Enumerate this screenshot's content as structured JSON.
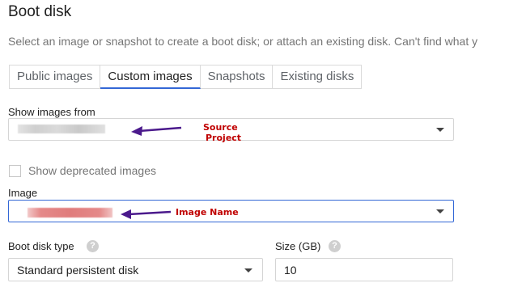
{
  "title": "Boot disk",
  "description": "Select an image or snapshot to create a boot disk; or attach an existing disk. Can't find what y",
  "tabs": [
    {
      "label": "Public images"
    },
    {
      "label": "Custom images"
    },
    {
      "label": "Snapshots"
    },
    {
      "label": "Existing disks"
    }
  ],
  "active_tab": "Custom images",
  "show_images_from": {
    "label": "Show images from",
    "value": ""
  },
  "deprecated_checkbox": {
    "label": "Show deprecated images",
    "checked": false
  },
  "image": {
    "label": "Image",
    "value": ""
  },
  "boot_disk_type": {
    "label": "Boot disk type",
    "value": "Standard persistent disk"
  },
  "size": {
    "label": "Size (GB)",
    "value": "10"
  },
  "annotations": {
    "source_project_line1": "Source",
    "source_project_line2": "Project",
    "image_name": "Image Name"
  },
  "colors": {
    "accent": "#3367d6",
    "annotation_text": "#c00000",
    "annotation_arrow": "#4b1a8c"
  }
}
